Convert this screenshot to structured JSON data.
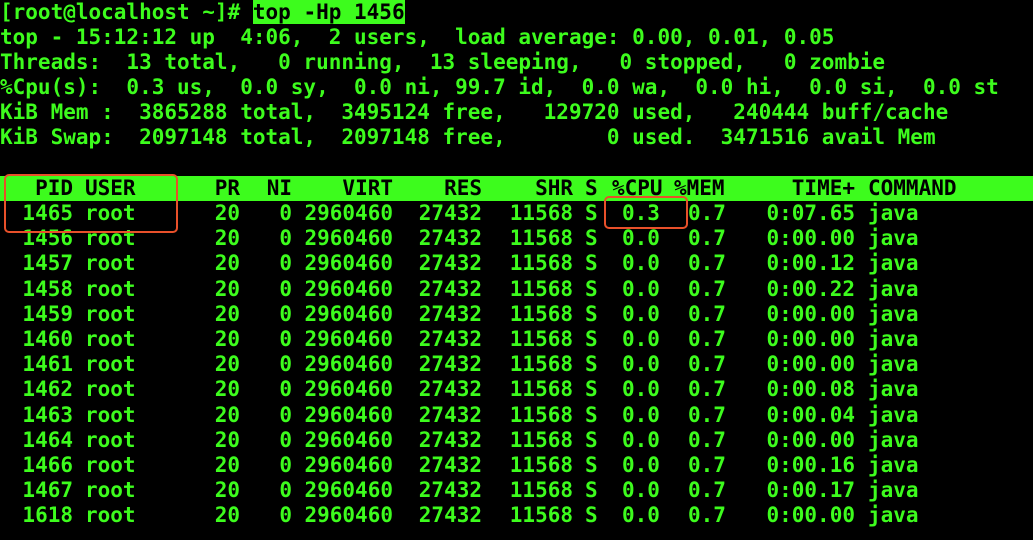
{
  "prompt": "[root@localhost ~]# ",
  "command": "top -Hp 1456",
  "summary": {
    "line1": "top - 15:12:12 up  4:06,  2 users,  load average: 0.00, 0.01, 0.05",
    "line2": "Threads:  13 total,   0 running,  13 sleeping,   0 stopped,   0 zombie",
    "line3": "%Cpu(s):  0.3 us,  0.0 sy,  0.0 ni, 99.7 id,  0.0 wa,  0.0 hi,  0.0 si,  0.0 st",
    "line4": "KiB Mem :  3865288 total,  3495124 free,   129720 used,   240444 buff/cache",
    "line5": "KiB Swap:  2097148 total,  2097148 free,        0 used.  3471516 avail Mem"
  },
  "columns": {
    "pid": "PID",
    "user": "USER",
    "pr": "PR",
    "ni": "NI",
    "virt": "VIRT",
    "res": "RES",
    "shr": "SHR",
    "s": "S",
    "cpu": "%CPU",
    "mem": "%MEM",
    "time": "TIME+",
    "command": "COMMAND"
  },
  "rows": [
    {
      "pid": "1465",
      "user": "root",
      "pr": "20",
      "ni": "0",
      "virt": "2960460",
      "res": "27432",
      "shr": "11568",
      "s": "S",
      "cpu": "0.3",
      "mem": "0.7",
      "time": "0:07.65",
      "command": "java"
    },
    {
      "pid": "1456",
      "user": "root",
      "pr": "20",
      "ni": "0",
      "virt": "2960460",
      "res": "27432",
      "shr": "11568",
      "s": "S",
      "cpu": "0.0",
      "mem": "0.7",
      "time": "0:00.00",
      "command": "java"
    },
    {
      "pid": "1457",
      "user": "root",
      "pr": "20",
      "ni": "0",
      "virt": "2960460",
      "res": "27432",
      "shr": "11568",
      "s": "S",
      "cpu": "0.0",
      "mem": "0.7",
      "time": "0:00.12",
      "command": "java"
    },
    {
      "pid": "1458",
      "user": "root",
      "pr": "20",
      "ni": "0",
      "virt": "2960460",
      "res": "27432",
      "shr": "11568",
      "s": "S",
      "cpu": "0.0",
      "mem": "0.7",
      "time": "0:00.22",
      "command": "java"
    },
    {
      "pid": "1459",
      "user": "root",
      "pr": "20",
      "ni": "0",
      "virt": "2960460",
      "res": "27432",
      "shr": "11568",
      "s": "S",
      "cpu": "0.0",
      "mem": "0.7",
      "time": "0:00.00",
      "command": "java"
    },
    {
      "pid": "1460",
      "user": "root",
      "pr": "20",
      "ni": "0",
      "virt": "2960460",
      "res": "27432",
      "shr": "11568",
      "s": "S",
      "cpu": "0.0",
      "mem": "0.7",
      "time": "0:00.00",
      "command": "java"
    },
    {
      "pid": "1461",
      "user": "root",
      "pr": "20",
      "ni": "0",
      "virt": "2960460",
      "res": "27432",
      "shr": "11568",
      "s": "S",
      "cpu": "0.0",
      "mem": "0.7",
      "time": "0:00.00",
      "command": "java"
    },
    {
      "pid": "1462",
      "user": "root",
      "pr": "20",
      "ni": "0",
      "virt": "2960460",
      "res": "27432",
      "shr": "11568",
      "s": "S",
      "cpu": "0.0",
      "mem": "0.7",
      "time": "0:00.08",
      "command": "java"
    },
    {
      "pid": "1463",
      "user": "root",
      "pr": "20",
      "ni": "0",
      "virt": "2960460",
      "res": "27432",
      "shr": "11568",
      "s": "S",
      "cpu": "0.0",
      "mem": "0.7",
      "time": "0:00.04",
      "command": "java"
    },
    {
      "pid": "1464",
      "user": "root",
      "pr": "20",
      "ni": "0",
      "virt": "2960460",
      "res": "27432",
      "shr": "11568",
      "s": "S",
      "cpu": "0.0",
      "mem": "0.7",
      "time": "0:00.00",
      "command": "java"
    },
    {
      "pid": "1466",
      "user": "root",
      "pr": "20",
      "ni": "0",
      "virt": "2960460",
      "res": "27432",
      "shr": "11568",
      "s": "S",
      "cpu": "0.0",
      "mem": "0.7",
      "time": "0:00.16",
      "command": "java"
    },
    {
      "pid": "1467",
      "user": "root",
      "pr": "20",
      "ni": "0",
      "virt": "2960460",
      "res": "27432",
      "shr": "11568",
      "s": "S",
      "cpu": "0.0",
      "mem": "0.7",
      "time": "0:00.17",
      "command": "java"
    },
    {
      "pid": "1618",
      "user": "root",
      "pr": "20",
      "ni": "0",
      "virt": "2960460",
      "res": "27432",
      "shr": "11568",
      "s": "S",
      "cpu": "0.0",
      "mem": "0.7",
      "time": "0:00.00",
      "command": "java"
    }
  ],
  "colors": {
    "text": "#3dfc1d",
    "background": "#000000",
    "highlight_box": "#e8502a"
  }
}
